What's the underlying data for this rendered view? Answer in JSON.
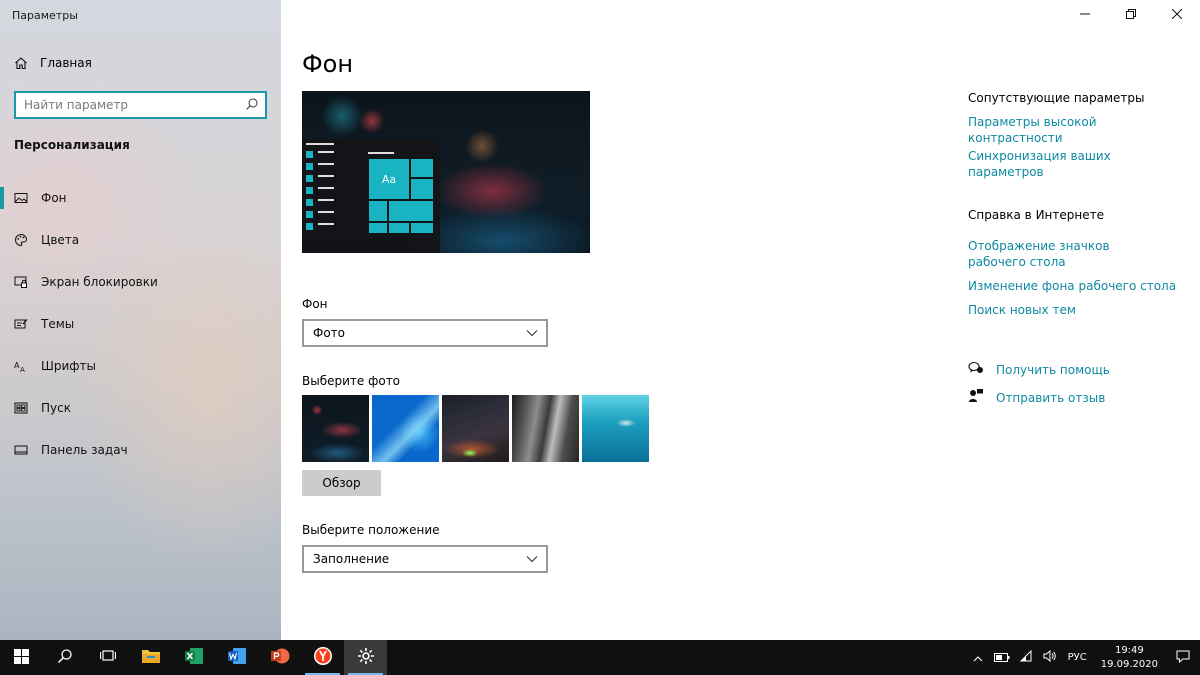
{
  "window": {
    "title": "Параметры",
    "controls": [
      "minimize-icon",
      "restore-icon",
      "close-icon"
    ]
  },
  "sidebar": {
    "home": {
      "label": "Главная",
      "icon": "home-icon"
    },
    "search": {
      "placeholder": "Найти параметр",
      "value": "",
      "icon": "search-icon"
    },
    "section_title": "Персонализация",
    "items": [
      {
        "label": "Фон",
        "icon": "picture-icon",
        "active": true
      },
      {
        "label": "Цвета",
        "icon": "palette-icon",
        "active": false
      },
      {
        "label": "Экран блокировки",
        "icon": "lock-screen-icon",
        "active": false
      },
      {
        "label": "Темы",
        "icon": "themes-icon",
        "active": false
      },
      {
        "label": "Шрифты",
        "icon": "fonts-icon",
        "active": false
      },
      {
        "label": "Пуск",
        "icon": "start-icon",
        "active": false
      },
      {
        "label": "Панель задач",
        "icon": "taskbar-icon",
        "active": false
      }
    ]
  },
  "main": {
    "title": "Фон",
    "preview": {
      "tile_text": "Aa"
    },
    "background": {
      "label": "Фон",
      "value": "Фото"
    },
    "choose_photo": {
      "label": "Выберите фото",
      "browse_label": "Обзор"
    },
    "position": {
      "label": "Выберите положение",
      "value": "Заполнение"
    }
  },
  "related": {
    "heading": "Сопутствующие параметры",
    "links": [
      "Параметры высокой контрастности",
      "Синхронизация ваших параметров"
    ]
  },
  "help": {
    "heading": "Справка в Интернете",
    "links": [
      "Отображение значков рабочего стола",
      "Изменение фона рабочего стола",
      "Поиск новых тем"
    ]
  },
  "support": {
    "get_help": "Получить помощь",
    "feedback": "Отправить отзыв"
  },
  "taskbar": {
    "apps": [
      "windows-start-icon",
      "search-icon",
      "task-view-icon",
      "file-explorer-icon",
      "excel-icon",
      "word-icon",
      "powerpoint-icon",
      "yandex-browser-icon",
      "settings-icon"
    ],
    "language": "РУС",
    "time": "19:49",
    "date": "19.09.2020"
  },
  "colors": {
    "accent": "#1a98a8",
    "link": "#0d8aa0",
    "taskbar": "#101010"
  }
}
